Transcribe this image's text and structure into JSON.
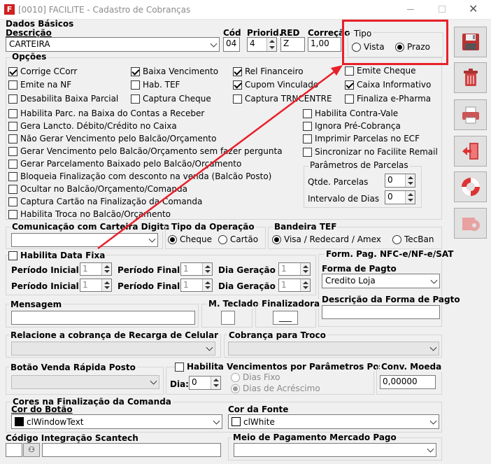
{
  "window": {
    "title": "[0010] FACILITE - Cadastro de Cobranças"
  },
  "basic": {
    "section": "Dados Básicos",
    "desc_label": "Descrição",
    "desc_value": "CARTEIRA",
    "cod_label": "Cód",
    "cod_value": "04",
    "priorid_label": "Priorid.",
    "priorid_value": "4",
    "red_label": "RED",
    "red_value": "Z",
    "correcao_label": "Correção",
    "correcao_value": "1,00"
  },
  "tipo": {
    "label": "Tipo",
    "vista": "Vista",
    "prazo": "Prazo"
  },
  "opcoes": {
    "label": "Opções",
    "row1": [
      "Corrige CCorr",
      "Baixa Vencimento",
      "Rel Financeiro",
      "Emite Cheque"
    ],
    "row2": [
      "Emite na NF",
      "Hab. TEF",
      "Cupom Vinculado",
      "Caixa Informativo"
    ],
    "row3": [
      "Desabilita Baixa Parcial",
      "Captura Cheque",
      "Captura TRNCENTRE",
      "Finaliza e-Pharma"
    ],
    "left": [
      "Habilita Parc. na Baixa do Contas a Receber",
      "Gera Lancto. Débito/Crédito no Caixa",
      "Não Gerar Vencimento pelo Balcão/Orçamento",
      "Gerar Vencimento pelo Balcão/Orçamento sem fazer pergunta",
      "Gerar Parcelamento Baixado pelo Balcão/Orçamento",
      "Bloqueia Finalização com desconto na venda (Balcão Posto)",
      "Ocultar no Balcão/Orçamento/Comanda",
      "Captura Cartão na Finalização da Comanda",
      "Habilita Troca no Balcão/Orçamento"
    ],
    "right": [
      "Habilita Contra-Vale",
      "Ignora Pré-Cobrança",
      "Imprimir Parcelas no ECF",
      "Sincronizar no Facilite Remail"
    ],
    "parc_label": "Parâmetros de Parcelas",
    "qtde_label": "Qtde. Parcelas",
    "qtde_value": "0",
    "interv_label": "Intervalo de Dias",
    "interv_value": "0"
  },
  "comunic": {
    "label": "Comunicação com Carteira Digital",
    "value": ""
  },
  "tipo_op": {
    "label": "Tipo da Operação",
    "cheque": "Cheque",
    "cartao": "Cartão"
  },
  "bandeira": {
    "label": "Bandeira TEF",
    "visa": "Visa / Redecard / Amex",
    "tecban": "TecBan"
  },
  "datafixa": {
    "label": "Habilita Data Fixa",
    "pi1": "Período Inicial 1",
    "pi1v": "1",
    "pf1": "Período Final 1",
    "pf1v": "1",
    "dg1": "Dia Geração 1",
    "dg1v": "1",
    "pi2": "Período Inicial 2",
    "pi2v": "1",
    "pf2": "Período Final 2",
    "pf2v": "1",
    "dg2": "Dia Geração 2",
    "dg2v": "1"
  },
  "formpag": {
    "title": "Form. Pag. NFC-e/NF-e/SAT",
    "forma_label": "Forma de Pagto",
    "forma_value": "Credito Loja",
    "desc_label": "Descrição da Forma de Pagto"
  },
  "mensagem": {
    "label": "Mensagem",
    "mteclado": "M. Teclado",
    "finalizadora": "Finalizadora",
    "fin_value": "___"
  },
  "recarga": {
    "label": "Relacione a cobrança de Recarga de Celular",
    "troco_label": "Cobrança para Troco"
  },
  "botao": {
    "label": "Botão Venda Rápida Posto",
    "hab_label": "Habilita Vencimentos por Parâmetros Posto",
    "dia_label": "Dia:",
    "dia_value": "0",
    "fixo": "Dias Fixo",
    "acrescimo": "Dias de Acréscimo",
    "moeda_label": "Conv. Moeda",
    "moeda_value": "0,00000"
  },
  "cores": {
    "label": "Cores na Finalização da Comanda",
    "botao_label": "Cor do Botão",
    "botao_value": "clWindowText",
    "botao_color": "#000000",
    "fonte_label": "Cor da Fonte",
    "fonte_value": "clWhite",
    "fonte_color": "#ffffff"
  },
  "scantech": {
    "label": "Código Integração Scantech",
    "mp_label": "Meio de Pagamento Mercado Pago"
  },
  "toolbar": {
    "save": "save-icon",
    "delete": "trash-icon",
    "print": "printer-icon",
    "exit": "exit-door-icon",
    "help": "lifebuoy-icon",
    "config": "gear-icon"
  },
  "annotation": {
    "color": "#e8202a"
  }
}
